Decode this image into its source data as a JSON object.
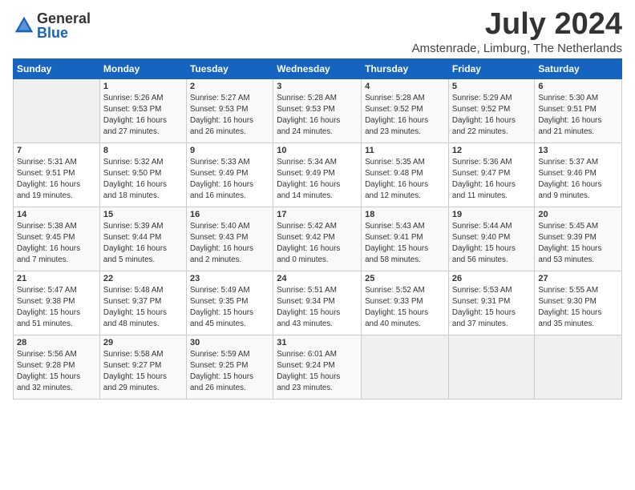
{
  "logo": {
    "general": "General",
    "blue": "Blue"
  },
  "title": "July 2024",
  "subtitle": "Amstenrade, Limburg, The Netherlands",
  "days_of_week": [
    "Sunday",
    "Monday",
    "Tuesday",
    "Wednesday",
    "Thursday",
    "Friday",
    "Saturday"
  ],
  "weeks": [
    [
      {
        "day": "",
        "info": ""
      },
      {
        "day": "1",
        "info": "Sunrise: 5:26 AM\nSunset: 9:53 PM\nDaylight: 16 hours\nand 27 minutes."
      },
      {
        "day": "2",
        "info": "Sunrise: 5:27 AM\nSunset: 9:53 PM\nDaylight: 16 hours\nand 26 minutes."
      },
      {
        "day": "3",
        "info": "Sunrise: 5:28 AM\nSunset: 9:53 PM\nDaylight: 16 hours\nand 24 minutes."
      },
      {
        "day": "4",
        "info": "Sunrise: 5:28 AM\nSunset: 9:52 PM\nDaylight: 16 hours\nand 23 minutes."
      },
      {
        "day": "5",
        "info": "Sunrise: 5:29 AM\nSunset: 9:52 PM\nDaylight: 16 hours\nand 22 minutes."
      },
      {
        "day": "6",
        "info": "Sunrise: 5:30 AM\nSunset: 9:51 PM\nDaylight: 16 hours\nand 21 minutes."
      }
    ],
    [
      {
        "day": "7",
        "info": "Sunrise: 5:31 AM\nSunset: 9:51 PM\nDaylight: 16 hours\nand 19 minutes."
      },
      {
        "day": "8",
        "info": "Sunrise: 5:32 AM\nSunset: 9:50 PM\nDaylight: 16 hours\nand 18 minutes."
      },
      {
        "day": "9",
        "info": "Sunrise: 5:33 AM\nSunset: 9:49 PM\nDaylight: 16 hours\nand 16 minutes."
      },
      {
        "day": "10",
        "info": "Sunrise: 5:34 AM\nSunset: 9:49 PM\nDaylight: 16 hours\nand 14 minutes."
      },
      {
        "day": "11",
        "info": "Sunrise: 5:35 AM\nSunset: 9:48 PM\nDaylight: 16 hours\nand 12 minutes."
      },
      {
        "day": "12",
        "info": "Sunrise: 5:36 AM\nSunset: 9:47 PM\nDaylight: 16 hours\nand 11 minutes."
      },
      {
        "day": "13",
        "info": "Sunrise: 5:37 AM\nSunset: 9:46 PM\nDaylight: 16 hours\nand 9 minutes."
      }
    ],
    [
      {
        "day": "14",
        "info": "Sunrise: 5:38 AM\nSunset: 9:45 PM\nDaylight: 16 hours\nand 7 minutes."
      },
      {
        "day": "15",
        "info": "Sunrise: 5:39 AM\nSunset: 9:44 PM\nDaylight: 16 hours\nand 5 minutes."
      },
      {
        "day": "16",
        "info": "Sunrise: 5:40 AM\nSunset: 9:43 PM\nDaylight: 16 hours\nand 2 minutes."
      },
      {
        "day": "17",
        "info": "Sunrise: 5:42 AM\nSunset: 9:42 PM\nDaylight: 16 hours\nand 0 minutes."
      },
      {
        "day": "18",
        "info": "Sunrise: 5:43 AM\nSunset: 9:41 PM\nDaylight: 15 hours\nand 58 minutes."
      },
      {
        "day": "19",
        "info": "Sunrise: 5:44 AM\nSunset: 9:40 PM\nDaylight: 15 hours\nand 56 minutes."
      },
      {
        "day": "20",
        "info": "Sunrise: 5:45 AM\nSunset: 9:39 PM\nDaylight: 15 hours\nand 53 minutes."
      }
    ],
    [
      {
        "day": "21",
        "info": "Sunrise: 5:47 AM\nSunset: 9:38 PM\nDaylight: 15 hours\nand 51 minutes."
      },
      {
        "day": "22",
        "info": "Sunrise: 5:48 AM\nSunset: 9:37 PM\nDaylight: 15 hours\nand 48 minutes."
      },
      {
        "day": "23",
        "info": "Sunrise: 5:49 AM\nSunset: 9:35 PM\nDaylight: 15 hours\nand 45 minutes."
      },
      {
        "day": "24",
        "info": "Sunrise: 5:51 AM\nSunset: 9:34 PM\nDaylight: 15 hours\nand 43 minutes."
      },
      {
        "day": "25",
        "info": "Sunrise: 5:52 AM\nSunset: 9:33 PM\nDaylight: 15 hours\nand 40 minutes."
      },
      {
        "day": "26",
        "info": "Sunrise: 5:53 AM\nSunset: 9:31 PM\nDaylight: 15 hours\nand 37 minutes."
      },
      {
        "day": "27",
        "info": "Sunrise: 5:55 AM\nSunset: 9:30 PM\nDaylight: 15 hours\nand 35 minutes."
      }
    ],
    [
      {
        "day": "28",
        "info": "Sunrise: 5:56 AM\nSunset: 9:28 PM\nDaylight: 15 hours\nand 32 minutes."
      },
      {
        "day": "29",
        "info": "Sunrise: 5:58 AM\nSunset: 9:27 PM\nDaylight: 15 hours\nand 29 minutes."
      },
      {
        "day": "30",
        "info": "Sunrise: 5:59 AM\nSunset: 9:25 PM\nDaylight: 15 hours\nand 26 minutes."
      },
      {
        "day": "31",
        "info": "Sunrise: 6:01 AM\nSunset: 9:24 PM\nDaylight: 15 hours\nand 23 minutes."
      },
      {
        "day": "",
        "info": ""
      },
      {
        "day": "",
        "info": ""
      },
      {
        "day": "",
        "info": ""
      }
    ]
  ]
}
